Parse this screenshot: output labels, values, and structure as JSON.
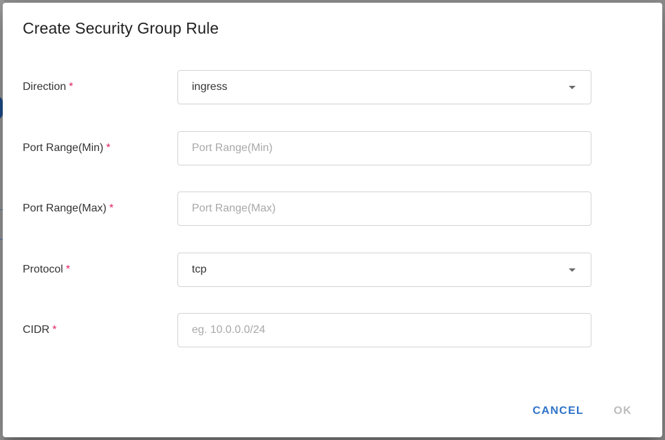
{
  "dialog": {
    "title": "Create Security Group Rule",
    "fields": [
      {
        "label": "Direction",
        "required_mark": "*",
        "type": "select",
        "value": "ingress"
      },
      {
        "label": "Port Range(Min)",
        "required_mark": "*",
        "type": "input",
        "value": "",
        "placeholder": "Port Range(Min)"
      },
      {
        "label": "Port Range(Max)",
        "required_mark": "*",
        "type": "input",
        "value": "",
        "placeholder": "Port Range(Max)"
      },
      {
        "label": "Protocol",
        "required_mark": "*",
        "type": "select",
        "value": "tcp"
      },
      {
        "label": "CIDR",
        "required_mark": "*",
        "type": "input",
        "value": "",
        "placeholder": "eg. 10.0.0.0/24"
      }
    ],
    "actions": {
      "cancel_label": "CANCEL",
      "ok_label": "OK"
    }
  },
  "colors": {
    "accent": "#2f74c8",
    "required": "#e0245e",
    "disabled": "#bdbdbd",
    "overlay": "#8e8e8e"
  }
}
